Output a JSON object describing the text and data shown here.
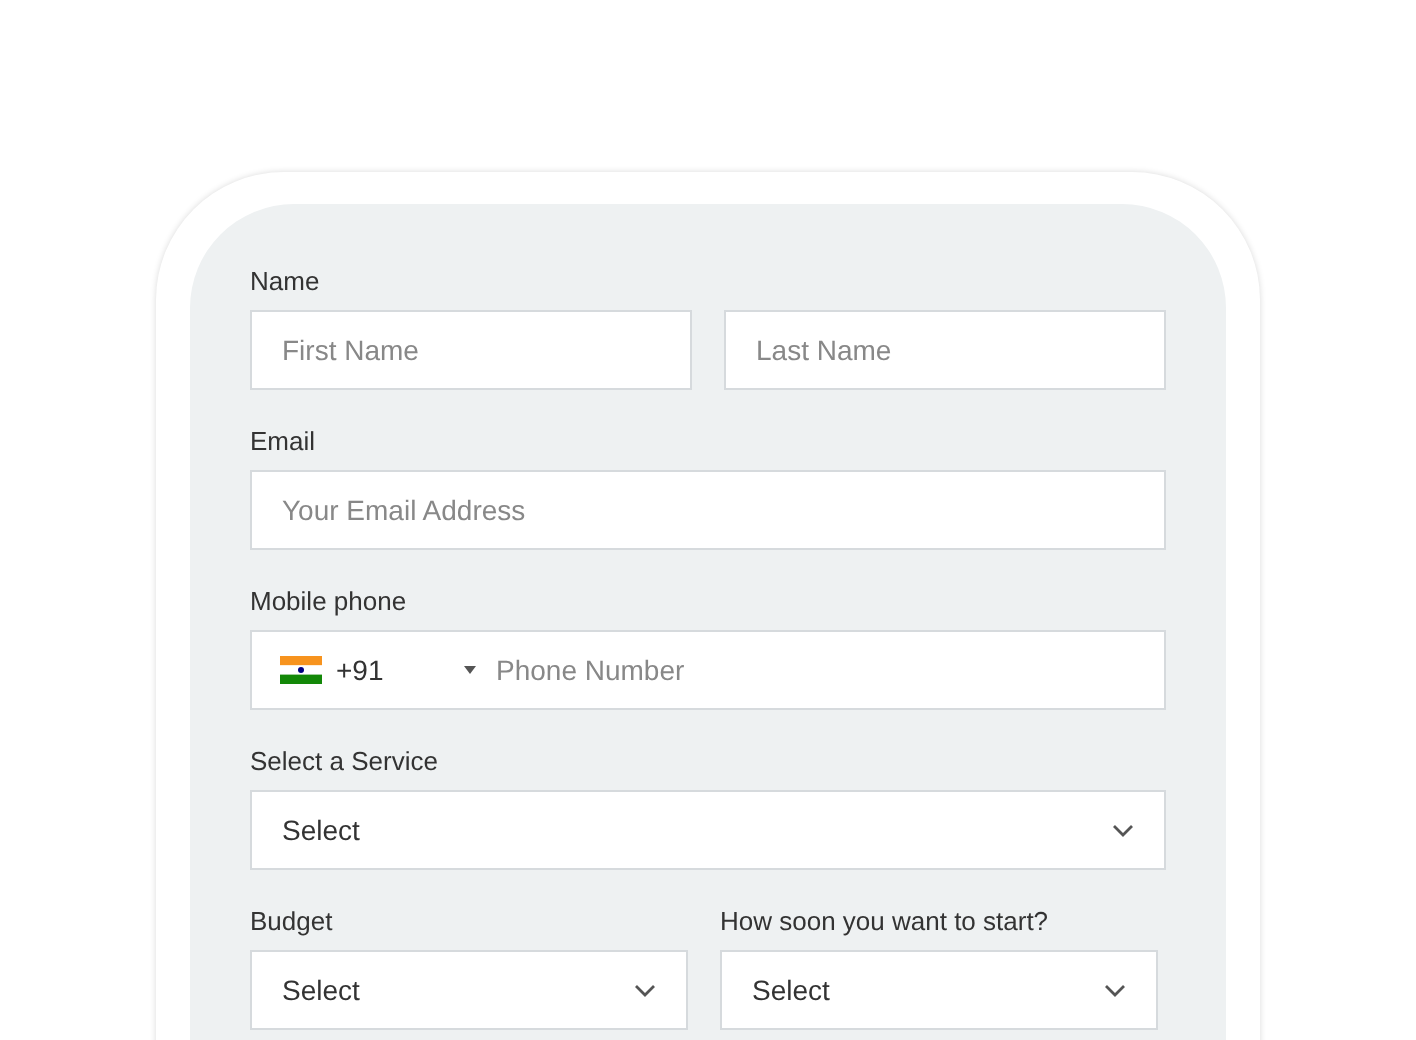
{
  "name": {
    "label": "Name",
    "fields": [
      {
        "placeholder": "First Name"
      },
      {
        "placeholder": "Last Name"
      }
    ]
  },
  "email": {
    "label": "Email",
    "placeholder": "Your Email Address"
  },
  "mobile_phone": {
    "label": "Mobile phone",
    "country_code": "+91",
    "placeholder": "Phone Number"
  },
  "service": {
    "label": "Select a Service",
    "value": "Select"
  },
  "half_selects": [
    {
      "label": "Budget",
      "value": "Select"
    },
    {
      "label": "How soon you want to start?",
      "value": "Select"
    }
  ]
}
